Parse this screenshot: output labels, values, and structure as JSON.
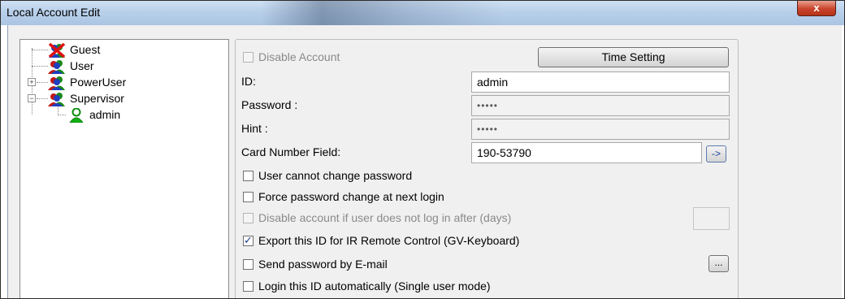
{
  "window": {
    "title": "Local Account Edit",
    "close_glyph": "x"
  },
  "tree": {
    "items": [
      {
        "label": "Guest",
        "icon": "user-denied-icon"
      },
      {
        "label": "User",
        "icon": "user-group-icon"
      },
      {
        "label": "PowerUser",
        "icon": "user-group-icon"
      },
      {
        "label": "Supervisor",
        "icon": "user-group-icon"
      },
      {
        "label": "admin",
        "icon": "user-icon"
      }
    ],
    "expand_glyph": "+",
    "collapse_glyph": "−"
  },
  "form": {
    "disable_account": "Disable Account",
    "time_setting": "Time Setting",
    "id_label": "ID:",
    "id_value": "admin",
    "password_label": "Password :",
    "password_value": "•••••",
    "hint_label": "Hint :",
    "hint_value": "•••••",
    "card_label": "Card Number Field:",
    "card_value": "190-53790",
    "card_button": "->",
    "options": [
      {
        "label": "User cannot change password",
        "checked": false,
        "enabled": true
      },
      {
        "label": "Force password change at next login",
        "checked": false,
        "enabled": true
      },
      {
        "label": "Disable account if user does not log in after (days)",
        "checked": false,
        "enabled": false
      },
      {
        "label": "Export this ID for IR Remote Control (GV-Keyboard)",
        "checked": true,
        "enabled": true
      },
      {
        "label": "Send password by E-mail",
        "checked": false,
        "enabled": true
      },
      {
        "label": "Login this ID automatically (Single user mode)",
        "checked": false,
        "enabled": true
      }
    ],
    "email_button": "...",
    "check_glyph": "✓"
  }
}
